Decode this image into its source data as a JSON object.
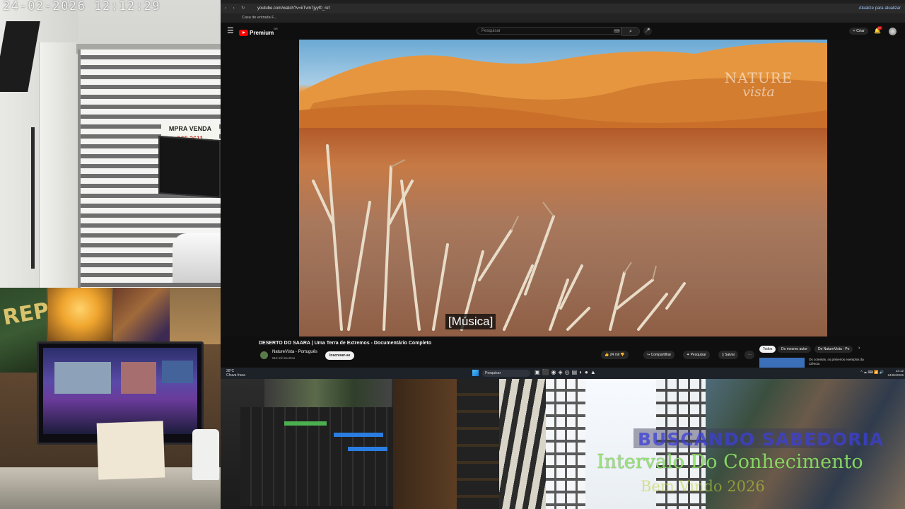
{
  "security_cam": {
    "timestamp": "24-02-2026  12:12:29",
    "sign_text": "MPRA VENDA",
    "sign_phone": "965 2611"
  },
  "browser": {
    "url": "youtube.com/watch?v=kTvm7jyyf0_ref",
    "bookmark": "Casa de entrada F...",
    "right_info": "Atualize para atualizar"
  },
  "youtube": {
    "logo_text": "Premium",
    "logo_sup": "BR",
    "search_placeholder": "Pesquisar",
    "create_label": "+ Criar",
    "notification_count": "9+",
    "video": {
      "watermark_line1": "NATURE",
      "watermark_line2": "vista",
      "caption": "[Música]"
    },
    "title": "DESERTO DO SAARA | Uma Terra de Extremos - Documentário Completo",
    "channel_name": "NatureVista - Português",
    "channel_subs": "613 mil inscritos",
    "subscribe_label": "Inscrever-se",
    "like_label": "👍 24 mil",
    "dislike_icon": "👎",
    "share_label": "Compartilhar",
    "search_label": "Pesquisar",
    "save_label": "Salvar",
    "more_label": "⋯",
    "chips": [
      "Todos",
      "Do mesmo autor",
      "De NatureVista - Po"
    ],
    "chip_next": "›",
    "recommended_title": "Os cometas, os primeiros exemplos da Ciência"
  },
  "taskbar": {
    "weather_temp": "28°C",
    "weather_text": "Chuva fraca",
    "search_label": "Pesquisar",
    "app_icons": "▣⬛◉◈◎▤◐●▲",
    "tray": "^ ☁ ⌨ 📶 🔊",
    "time": "12:12",
    "date": "24/02/2026"
  },
  "desk_cam": {
    "wall_art_text": "REP"
  },
  "room_cam": {
    "overlay_line1": "BUSCANDO SABEDORIA",
    "overlay_line2": "Intervalo Do Conhecimento",
    "overlay_line3": "Bem Vindo 2026"
  },
  "colors": {
    "youtube_red": "#ff0000",
    "overlay_blue": "#3c3fd8",
    "overlay_green": "#8fe36a",
    "overlay_yellow": "#c4d236"
  }
}
